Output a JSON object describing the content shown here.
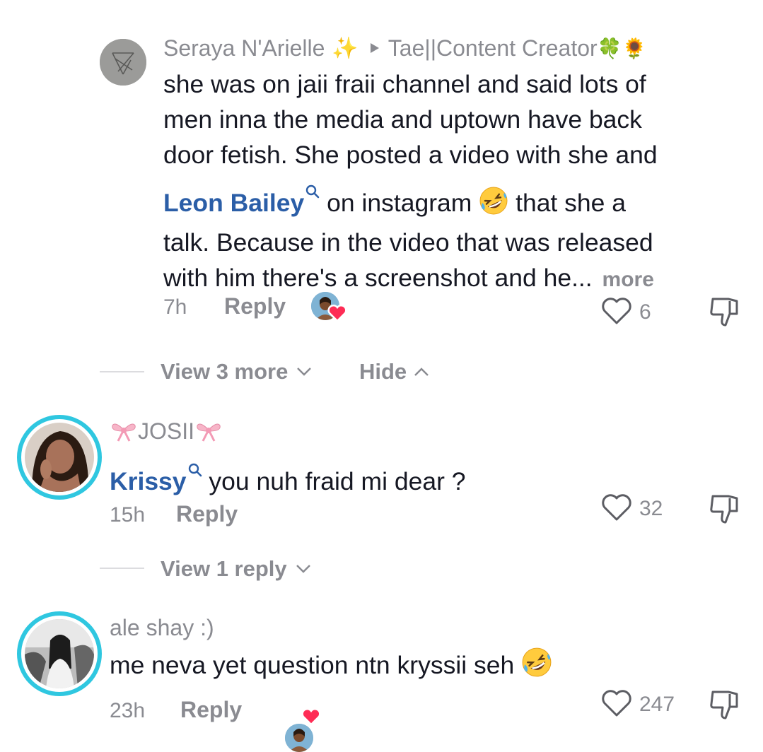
{
  "comment1": {
    "username": "Seraya N'Arielle",
    "sparkle": "✨",
    "reply_to": "Tae||Content Creator",
    "reply_to_emojis": "🍀🌻",
    "lines": [
      "she was on jaii fraii channel and said lots of",
      "men inna the media and uptown have back",
      "door fetish. She posted a video with she and"
    ],
    "mention": "Leon Bailey",
    "line4_after_mention": " on instagram ",
    "line4_after_emoji": " that she a",
    "line5": "talk. Because in the video that was released",
    "line6": "with him there's a screenshot and he...",
    "more": "more",
    "time": "7h",
    "reply": "Reply",
    "likes": "6"
  },
  "thread_controls": {
    "view_more": "View 3 more",
    "hide": "Hide"
  },
  "comment2": {
    "username": "JOSII",
    "mention": "Krissy",
    "text": " you nuh fraid mi dear ?",
    "time": "15h",
    "reply": "Reply",
    "likes": "32",
    "view_replies": "View 1 reply"
  },
  "comment3": {
    "username": "ale shay :)",
    "text": "me neva yet question ntn kryssii seh",
    "time": "23h",
    "reply": "Reply",
    "likes": "247"
  },
  "icons": {
    "heart": "heart-outline-icon",
    "dislike": "thumbs-down-icon",
    "search": "search-icon",
    "play": "play-triangle-icon",
    "chevron_down": "chevron-down-icon",
    "chevron_up": "chevron-up-icon",
    "laughing_emoji": "rolling-laughing-emoji",
    "bow_emoji": "ribbon-emoji"
  },
  "colors": {
    "mention": "#2b5ea7",
    "muted": "#8a8b91",
    "ring": "#2fc7e0",
    "text": "#161823",
    "creator_heart": "#fe2c55"
  }
}
